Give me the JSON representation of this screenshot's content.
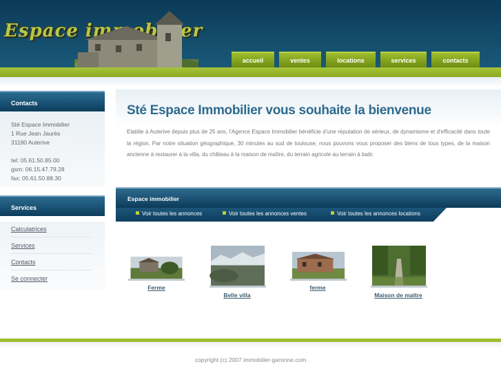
{
  "header": {
    "logo_text": "Espace immobilier",
    "nav": [
      {
        "label": "accueil"
      },
      {
        "label": "ventes"
      },
      {
        "label": "locations"
      },
      {
        "label": "services"
      },
      {
        "label": "contacts"
      }
    ]
  },
  "sidebar": {
    "contacts_title": "Contacts",
    "company": "Sté Espace Immobilier",
    "address1": "1 Rue Jean Jaurès",
    "address2": "31190 Auterive",
    "tel": "tel: 05.61.50.85.00",
    "gsm": "gsm: 06.15.47.79.28",
    "fax": "fax: 05.61.50.88.30",
    "services_title": "Services",
    "links": [
      {
        "label": "Calculatrices"
      },
      {
        "label": "Services"
      },
      {
        "label": "Contacts"
      },
      {
        "label": "Se connecter"
      }
    ]
  },
  "main": {
    "title": "Sté Espace Immobilier vous souhaite la bienvenue",
    "intro": "Etablie à Auterive depuis plus de 25 ans, l'Agence Espace Immobilier bénéficie d'une réputation de sérieux, de dynamisme et d'efficacité dans toute la région. Par notre situation géographique, 30 minutes au sud de toulouse, nous pouvons vous proposer des biens de tous types, de la maison ancienne à restaurer à la villa, du château à la maison de maître, du terrain agricole au terrain à batir.",
    "band_title": "Espace immobilier",
    "band_links": [
      {
        "label": "Voir toutes les annonces"
      },
      {
        "label": "Voir toutes les annonces ventes"
      },
      {
        "label": "Voir toutes les annonces locations"
      }
    ],
    "properties": [
      {
        "label": "Ferme"
      },
      {
        "label": "Belle villa"
      },
      {
        "label": "ferme"
      },
      {
        "label": "Maison de maître"
      }
    ]
  },
  "footer": {
    "copyright": "copyright (c) 2007 immobilier-garonne.com"
  },
  "colors": {
    "header_blue": "#0c3957",
    "accent_green": "#9fbd31",
    "title_blue": "#2e6b8e"
  }
}
